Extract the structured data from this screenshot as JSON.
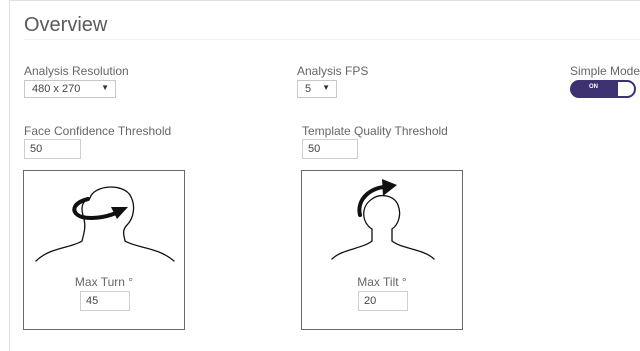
{
  "page": {
    "title": "Overview"
  },
  "analysis_resolution": {
    "label": "Analysis Resolution",
    "value": "480 x 270"
  },
  "analysis_fps": {
    "label": "Analysis FPS",
    "value": "5"
  },
  "simple_mode": {
    "label": "Simple Mode",
    "state": "ON"
  },
  "face_confidence": {
    "label": "Face Confidence Threshold",
    "value": "50"
  },
  "template_quality": {
    "label": "Template Quality Threshold",
    "value": "50"
  },
  "max_turn": {
    "label": "Max Turn °",
    "value": "45",
    "icon": "head-turn-icon"
  },
  "max_tilt": {
    "label": "Max Tilt °",
    "value": "20",
    "icon": "head-tilt-icon"
  },
  "colors": {
    "toggle_on": "#3d3172",
    "card_border": "#6a6a6a",
    "input_border": "#cfcfcf"
  }
}
